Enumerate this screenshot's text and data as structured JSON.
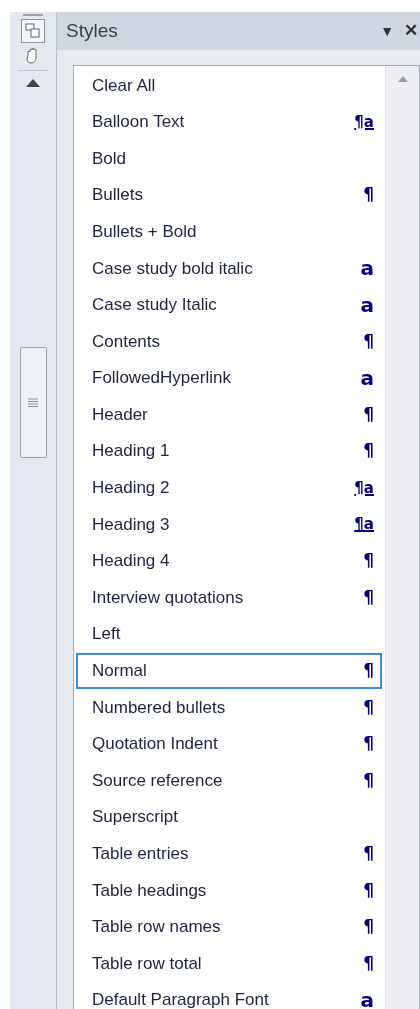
{
  "pane": {
    "title": "Styles",
    "menu_glyph": "▼",
    "close_glyph": "✕"
  },
  "styles": [
    {
      "name": "Clear All",
      "kind": "none",
      "selected": false
    },
    {
      "name": "Balloon Text",
      "kind": "linked",
      "marker": "¶a",
      "selected": false
    },
    {
      "name": "Bold",
      "kind": "none",
      "selected": false
    },
    {
      "name": "Bullets",
      "kind": "paragraph",
      "marker": "¶",
      "selected": false
    },
    {
      "name": "Bullets + Bold",
      "kind": "none",
      "selected": false
    },
    {
      "name": "Case study bold italic",
      "kind": "character",
      "marker": "a",
      "selected": false
    },
    {
      "name": "Case study Italic",
      "kind": "character",
      "marker": "a",
      "selected": false
    },
    {
      "name": "Contents",
      "kind": "paragraph",
      "marker": "¶",
      "selected": false
    },
    {
      "name": "FollowedHyperlink",
      "kind": "character",
      "marker": "a",
      "selected": false
    },
    {
      "name": "Header",
      "kind": "paragraph",
      "marker": "¶",
      "selected": false
    },
    {
      "name": "Heading 1",
      "kind": "paragraph",
      "marker": "¶",
      "selected": false
    },
    {
      "name": "Heading 2",
      "kind": "linked",
      "marker": "¶a",
      "selected": false
    },
    {
      "name": "Heading 3",
      "kind": "linked",
      "marker": "¶a",
      "selected": false
    },
    {
      "name": "Heading 4",
      "kind": "paragraph",
      "marker": "¶",
      "selected": false
    },
    {
      "name": "Interview quotations",
      "kind": "paragraph",
      "marker": "¶",
      "selected": false
    },
    {
      "name": "Left",
      "kind": "none",
      "selected": false
    },
    {
      "name": "Normal",
      "kind": "paragraph",
      "marker": "¶",
      "selected": true
    },
    {
      "name": "Numbered bullets",
      "kind": "paragraph",
      "marker": "¶",
      "selected": false
    },
    {
      "name": "Quotation Indent",
      "kind": "paragraph",
      "marker": "¶",
      "selected": false
    },
    {
      "name": "Source reference",
      "kind": "paragraph",
      "marker": "¶",
      "selected": false
    },
    {
      "name": "Superscript",
      "kind": "none",
      "selected": false
    },
    {
      "name": "Table entries",
      "kind": "paragraph",
      "marker": "¶",
      "selected": false
    },
    {
      "name": "Table headings",
      "kind": "paragraph",
      "marker": "¶",
      "selected": false
    },
    {
      "name": "Table row names",
      "kind": "paragraph",
      "marker": "¶",
      "selected": false
    },
    {
      "name": "Table row total",
      "kind": "paragraph",
      "marker": "¶",
      "selected": false
    },
    {
      "name": "Default Paragraph Font",
      "kind": "character",
      "marker": "a",
      "selected": false
    }
  ]
}
